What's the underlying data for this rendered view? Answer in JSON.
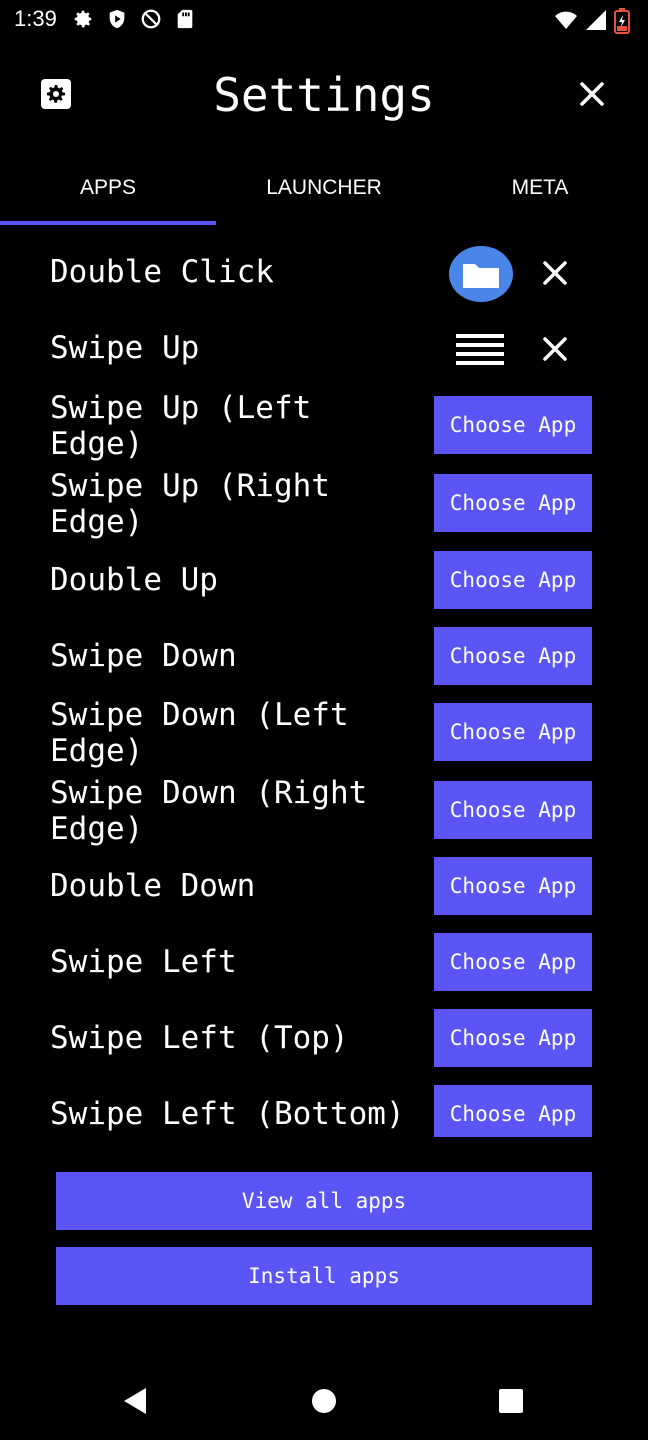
{
  "status_bar": {
    "time": "1:39",
    "left_icons": [
      "gear-icon",
      "shield-icon",
      "blocked-icon",
      "sd-card-icon"
    ],
    "right_icons": [
      "wifi-icon",
      "signal-icon",
      "battery-icon"
    ]
  },
  "header": {
    "title": "Settings",
    "left_icon": "gear-icon",
    "right_icon": "close-icon"
  },
  "tabs": [
    {
      "label": "APPS",
      "active": true
    },
    {
      "label": "LAUNCHER",
      "active": false
    },
    {
      "label": "META",
      "active": false
    }
  ],
  "gestures": [
    {
      "label": "Double Click",
      "action": "app-icon"
    },
    {
      "label": "Swipe Up",
      "action": "list-icon"
    },
    {
      "label": "Swipe Up (Left\nEdge)",
      "action": "Choose App"
    },
    {
      "label": "Swipe Up (Right\nEdge)",
      "action": "Choose App"
    },
    {
      "label": "Double Up",
      "action": "Choose App"
    },
    {
      "label": "Swipe Down",
      "action": "Choose App"
    },
    {
      "label": "Swipe Down (Left\nEdge)",
      "action": "Choose App"
    },
    {
      "label": "Swipe Down (Right\nEdge)",
      "action": "Choose App"
    },
    {
      "label": "Double Down",
      "action": "Choose App"
    },
    {
      "label": "Swipe Left",
      "action": "Choose App"
    },
    {
      "label": "Swipe Left (Top)",
      "action": "Choose App"
    },
    {
      "label": "Swipe Left (Bottom)",
      "action": "Choose App"
    }
  ],
  "choose_app_label": "Choose App",
  "buttons": {
    "view_all_apps": "View all apps",
    "install_apps": "Install apps"
  },
  "nav": {
    "back_icon": "back-triangle-icon",
    "home_icon": "home-circle-icon",
    "recents_icon": "recents-square-icon"
  },
  "colors": {
    "background": "#000000",
    "accent": "#5b55f5",
    "text": "#ffffff",
    "app_icon_bg": "#4a86e8"
  }
}
